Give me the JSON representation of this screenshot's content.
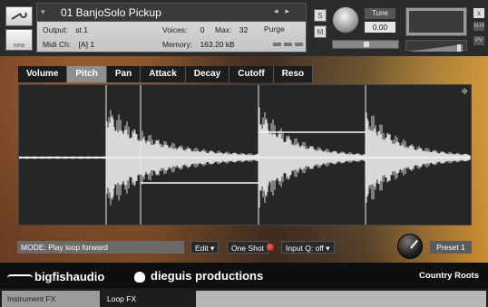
{
  "header": {
    "instrument_name": "01 BanjoSolo Pickup",
    "output_label": "Output:",
    "output_value": "st.1",
    "voices_label": "Voices:",
    "voices_value": "0",
    "max_label": "Max:",
    "max_value": "32",
    "purge_label": "Purge",
    "midi_label": "Midi Ch:",
    "midi_value": "[A] 1",
    "memory_label": "Memory:",
    "memory_value": "163.20 kB",
    "new_label": "new",
    "solo_label": "S",
    "mute_label": "M",
    "tune_label": "Tune",
    "tune_value": "0.00",
    "pan_marker": "◆",
    "close_label": "x",
    "side_aux": "AUX",
    "side_pv": "PV"
  },
  "tabs": [
    {
      "label": "Volume"
    },
    {
      "label": "Pitch"
    },
    {
      "label": "Pan"
    },
    {
      "label": "Attack"
    },
    {
      "label": "Decay"
    },
    {
      "label": "Cutoff"
    },
    {
      "label": "Reso"
    }
  ],
  "active_tab": "Pitch",
  "controls": {
    "mode": "MODE: Play loop forward",
    "edit": "Edit ▾",
    "one_shot": "One Shot",
    "input_q": "Input Q: off ▾",
    "preset": "Preset 1"
  },
  "footer": {
    "logo_left": "bigfishaudio",
    "logo_mid": "dieguis productions",
    "product": "Country Roots"
  },
  "bottom_tabs": {
    "instrument_fx": "Instrument FX",
    "loop_fx": "Loop FX"
  },
  "colors": {
    "active_tab": "#8e8e8e",
    "waveform": "#d8d8d8",
    "led": "#cc2222"
  },
  "icons": {
    "tool": "wrench-icon",
    "resize": "expand-icon"
  }
}
